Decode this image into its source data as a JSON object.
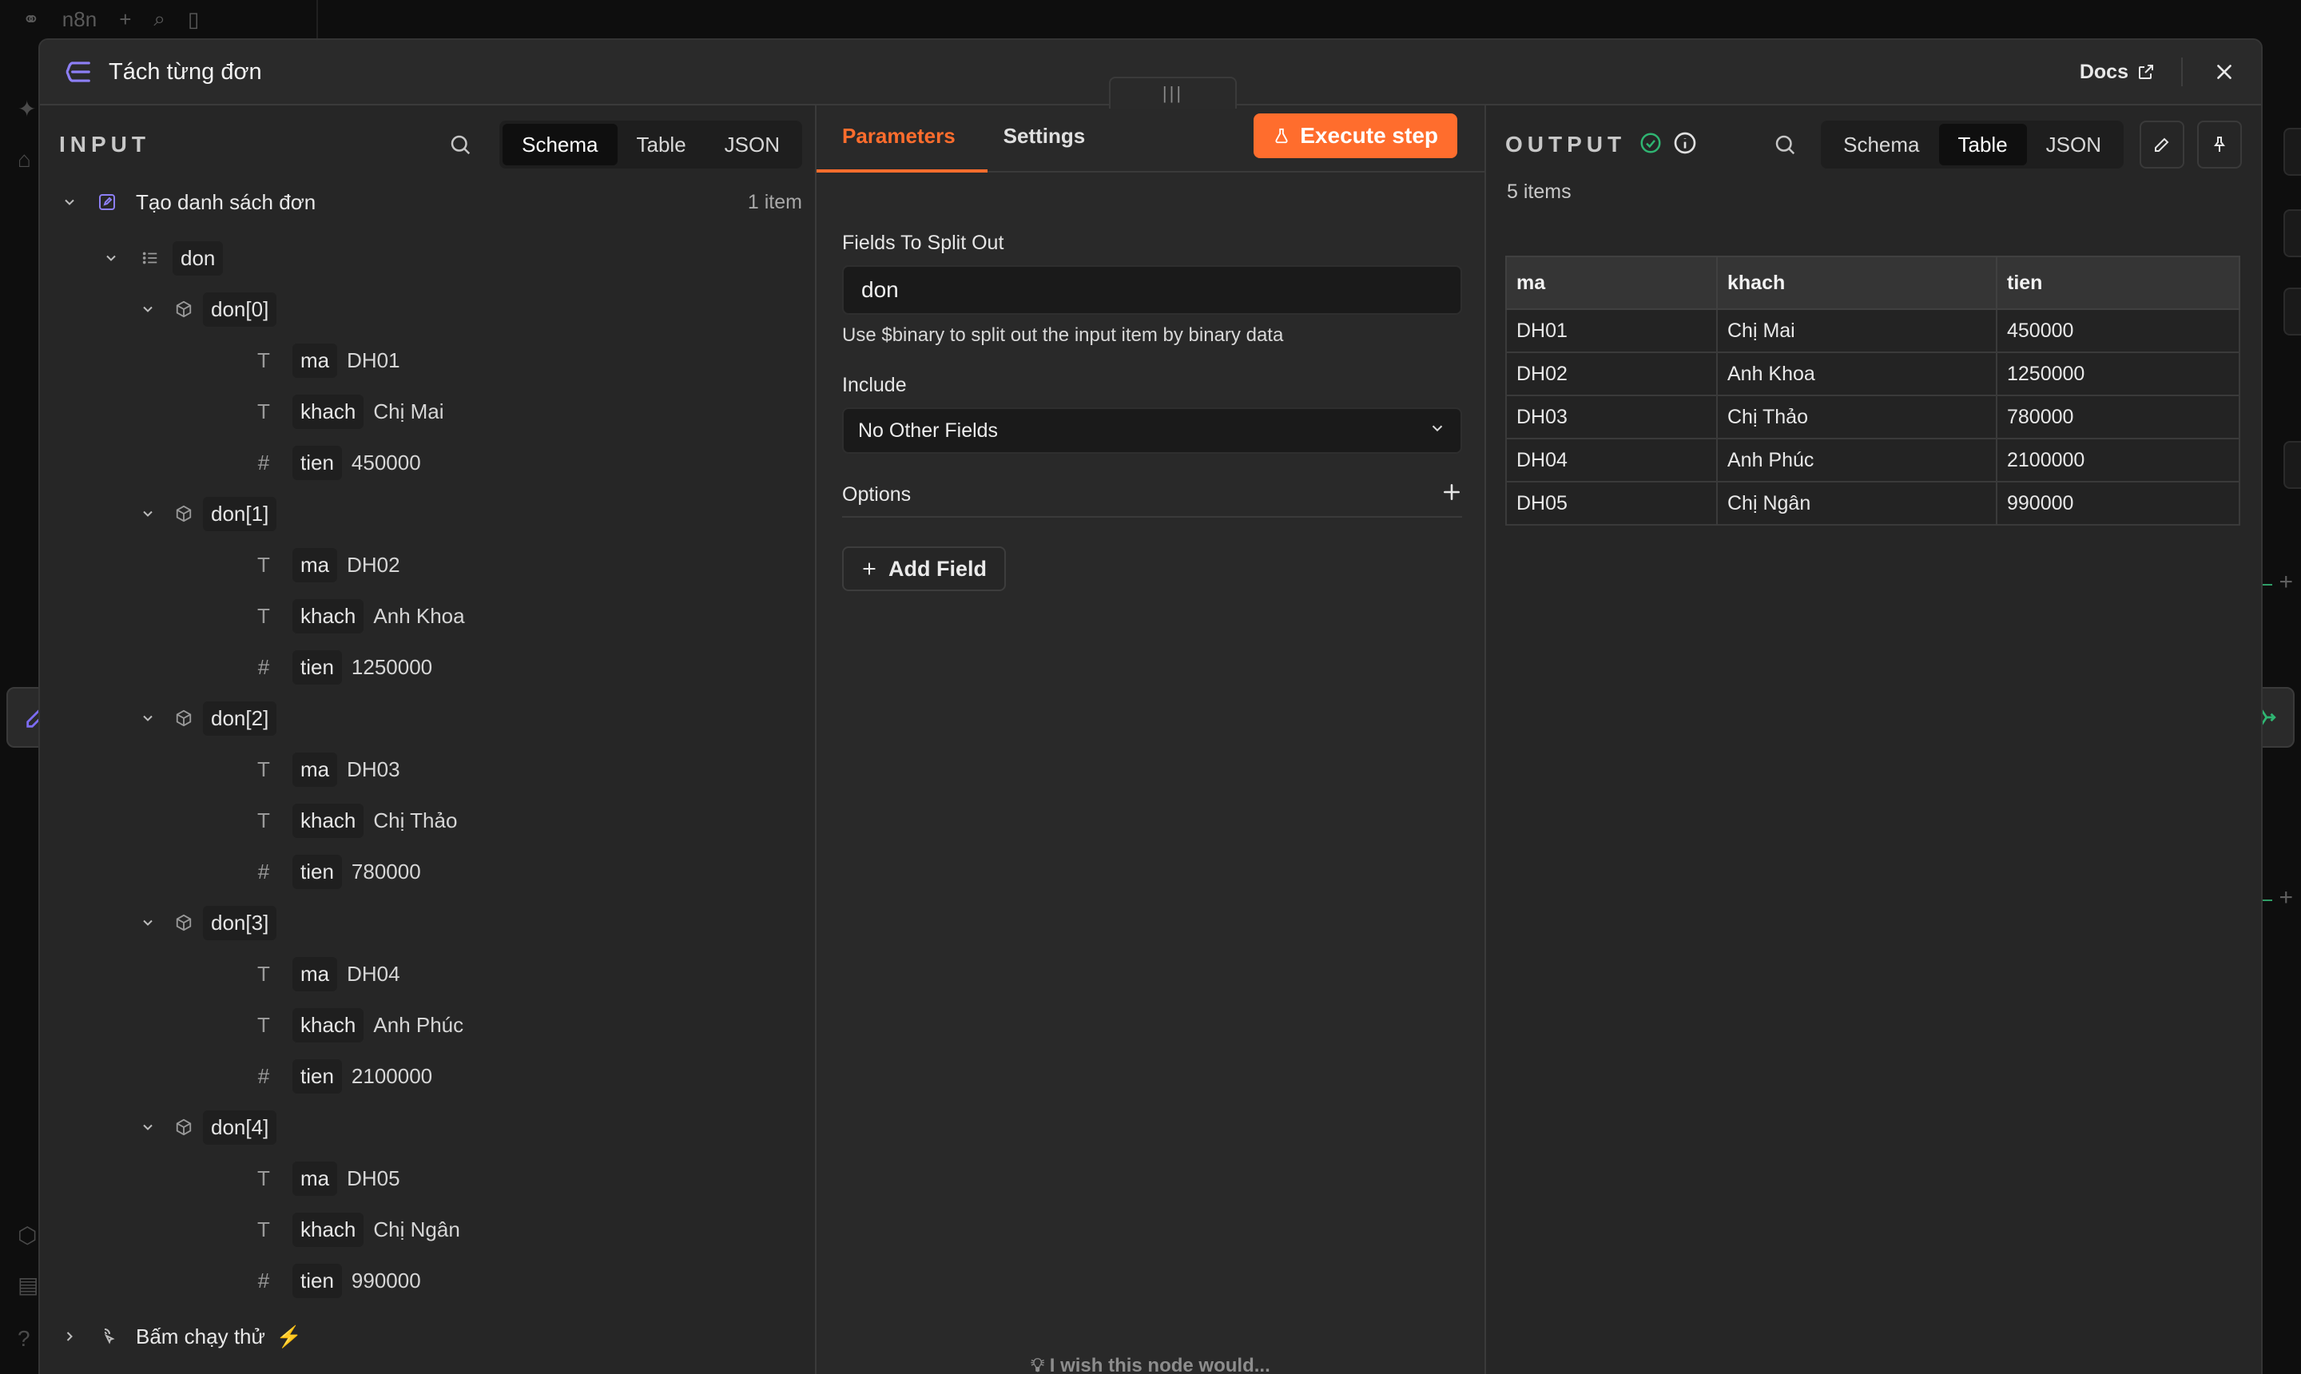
{
  "background": {
    "app_name": "n8n"
  },
  "modal": {
    "title": "Tách từng đơn",
    "docs_label": "Docs"
  },
  "input": {
    "label": "INPUT",
    "tabs": [
      "Schema",
      "Table",
      "JSON"
    ],
    "active_tab": "Schema",
    "source_node": "Tạo danh sách đơn",
    "item_count": "1 item",
    "array_key": "don",
    "entries": [
      {
        "index": "don[0]",
        "ma": "DH01",
        "khach": "Chị Mai",
        "tien": "450000"
      },
      {
        "index": "don[1]",
        "ma": "DH02",
        "khach": "Anh Khoa",
        "tien": "1250000"
      },
      {
        "index": "don[2]",
        "ma": "DH03",
        "khach": "Chị Thảo",
        "tien": "780000"
      },
      {
        "index": "don[3]",
        "ma": "DH04",
        "khach": "Anh Phúc",
        "tien": "2100000"
      },
      {
        "index": "don[4]",
        "ma": "DH05",
        "khach": "Chị Ngân",
        "tien": "990000"
      }
    ],
    "field_keys": {
      "ma": "ma",
      "khach": "khach",
      "tien": "tien"
    },
    "trigger_node": "Bấm chạy thử"
  },
  "params": {
    "tabs": [
      "Parameters",
      "Settings"
    ],
    "active_tab": "Parameters",
    "execute_label": "Execute step",
    "fields_to_split_label": "Fields To Split Out",
    "fields_to_split_value": "don",
    "binary_hint": "Use $binary to split out the input item by binary data",
    "include_label": "Include",
    "include_value": "No Other Fields",
    "options_label": "Options",
    "add_field_label": "Add Field",
    "wish_label": "I wish this node would..."
  },
  "output": {
    "label": "OUTPUT",
    "tabs": [
      "Schema",
      "Table",
      "JSON"
    ],
    "active_tab": "Table",
    "item_total": "5 items",
    "columns": [
      "ma",
      "khach",
      "tien"
    ],
    "rows": [
      [
        "DH01",
        "Chị Mai",
        "450000"
      ],
      [
        "DH02",
        "Anh Khoa",
        "1250000"
      ],
      [
        "DH03",
        "Chị Thảo",
        "780000"
      ],
      [
        "DH04",
        "Anh Phúc",
        "2100000"
      ],
      [
        "DH05",
        "Chị Ngân",
        "990000"
      ]
    ]
  },
  "colors": {
    "accent": "#ff6d2d",
    "success": "#2fb572",
    "node_icon": "#7c6cf2"
  },
  "icons": {
    "title": "split-out-icon",
    "docs": "external-link-icon",
    "close": "close-icon",
    "search": "search-icon",
    "execute": "flask-icon",
    "status": "check-circle-icon",
    "info": "info-icon",
    "edit": "pencil-icon",
    "pin": "pin-icon",
    "bulb": "lightbulb-icon"
  }
}
